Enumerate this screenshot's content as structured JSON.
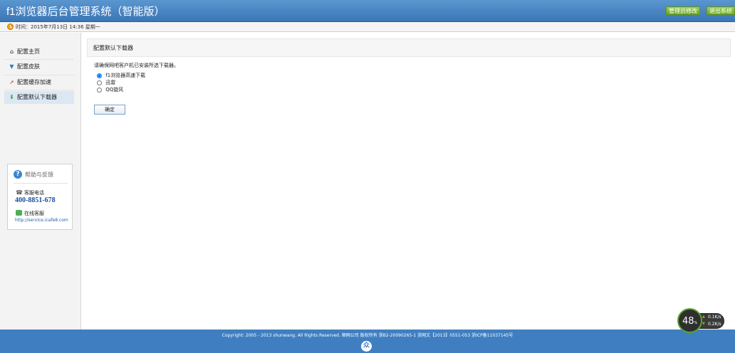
{
  "header": {
    "title": "f1浏览器后台管理系统（智能版）",
    "change_password": "管理员修改",
    "logout": "退出系统"
  },
  "timebar": {
    "text": "时间：2015年7月13日 14:36 星期一"
  },
  "sidebar": {
    "items": [
      {
        "label": "配置主页",
        "icon": "home-icon"
      },
      {
        "label": "配置皮肤",
        "icon": "shirt-icon"
      },
      {
        "label": "配置缓存加速",
        "icon": "rocket-icon"
      },
      {
        "label": "配置默认下载器",
        "icon": "download-icon"
      }
    ],
    "active_index": 3,
    "help": {
      "title": "帮助与反馈",
      "phone_label": "客服电话",
      "phone_number": "400-8851-678",
      "chat_label": "在线客服",
      "link": "http://service.icafe8.com"
    }
  },
  "main": {
    "panel_title": "配置默认下载器",
    "notice": "请确保网吧客户机已安装所选下载器。",
    "options": [
      {
        "label": "f1浏览器高速下载",
        "checked": true
      },
      {
        "label": "迅雷",
        "checked": false
      },
      {
        "label": "QQ旋风",
        "checked": false
      }
    ],
    "confirm_label": "确定"
  },
  "footer": {
    "copyright": "Copyright: 2005 - 2013 shunwang. All Rights Reserved. 顺网公司 版权所有  浙B2-20090265-1  浙网文【2013】0551-053  浙ICP备11037145号",
    "logo_glyph": "众"
  },
  "speed_widget": {
    "percent": "48",
    "percent_unit": "%",
    "up_rate": "0.1K/s",
    "down_rate": "0.2K/s"
  }
}
